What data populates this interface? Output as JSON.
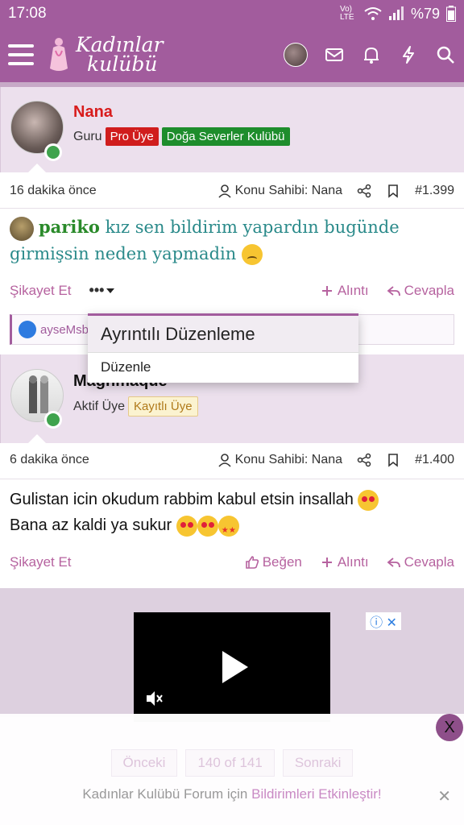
{
  "status_bar": {
    "time": "17:08",
    "signal_text": "Vo) LTE",
    "battery": "%79"
  },
  "header": {
    "logo_line1": "Kadınlar",
    "logo_line2": "kulübü"
  },
  "posts": [
    {
      "username": "Nana",
      "username_color": "#d81c1c",
      "role": "Guru",
      "badges": [
        "Pro Üye",
        "Doğa Severler Kulübü"
      ],
      "time_ago": "16 dakika önce",
      "owner_label": "Konu Sahibi: Nana",
      "post_number": "#1.399",
      "mention": "pariko",
      "message": "kız sen bildirim yapardın bugünde girmişsin neden yapmadin",
      "actions": {
        "report": "Şikayet Et",
        "more": "•••",
        "quote": "Alıntı",
        "reply": "Cevapla"
      },
      "reaction_user": "ayseMsb"
    },
    {
      "username": "Mağnmaque",
      "role": "Aktif Üye",
      "badges": [
        "Kayıtlı Üye"
      ],
      "time_ago": "6 dakika önce",
      "owner_label": "Konu Sahibi: Nana",
      "post_number": "#1.400",
      "message_line1": "Gulistan icin okudum rabbim kabul etsin insallah",
      "message_line2": "Bana az kaldi ya sukur",
      "actions": {
        "report": "Şikayet Et",
        "like": "Beğen",
        "quote": "Alıntı",
        "reply": "Cevapla"
      }
    }
  ],
  "dropdown": {
    "header": "Ayrıntılı Düzenleme",
    "item": "Düzenle"
  },
  "ad": {
    "close_label": "ⓘ ✕"
  },
  "pagination": {
    "prev": "Önceki",
    "current": "140 of 141",
    "next": "Sonraki"
  },
  "notification": {
    "prefix": "Kadınlar Kulübü Forum için",
    "link": "Bildirimleri Etkinleştir!"
  },
  "close_button": "X"
}
